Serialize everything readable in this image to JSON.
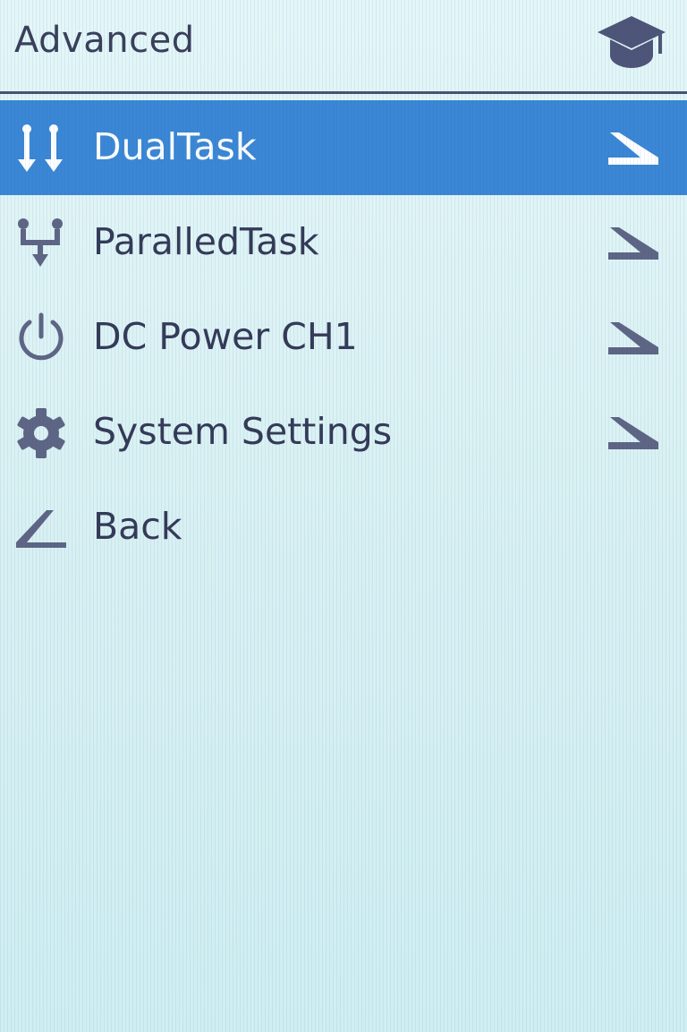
{
  "header": {
    "title": "Advanced",
    "icon": "graduation-cap-icon"
  },
  "menu": {
    "selected_index": 0,
    "items": [
      {
        "label": "DualTask",
        "icon": "dual-arrows-icon",
        "has_submenu": true
      },
      {
        "label": "ParalledTask",
        "icon": "fork-icon",
        "has_submenu": true
      },
      {
        "label": "DC Power CH1",
        "icon": "power-icon",
        "has_submenu": true
      },
      {
        "label": "System Settings",
        "icon": "gear-icon",
        "has_submenu": true
      },
      {
        "label": "Back",
        "icon": "back-icon",
        "has_submenu": false
      }
    ]
  },
  "colors": {
    "selected_bg": "#3b87d6",
    "text": "#353a58",
    "icon": "#5f6585",
    "background": "#dff3f5"
  }
}
